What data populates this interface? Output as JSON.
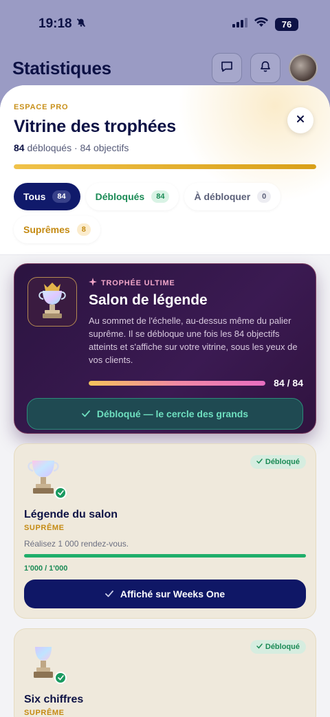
{
  "status_bar": {
    "time": "19:18",
    "battery": "76"
  },
  "header": {
    "title": "Statistiques"
  },
  "sheet": {
    "eyebrow": "ESPACE PRO",
    "title": "Vitrine des trophées",
    "unlocked_count": "84",
    "subtitle_rest": "débloqués · 84 objectifs",
    "progress": 1.0
  },
  "filters": [
    {
      "label": "Tous",
      "count": "84",
      "active": true
    },
    {
      "label": "Débloqués",
      "count": "84"
    },
    {
      "label": "À débloquer",
      "count": "0"
    },
    {
      "label": "Suprêmes",
      "count": "8"
    }
  ],
  "ultimate": {
    "eyebrow": "TROPHÉE ULTIME",
    "title": "Salon de légende",
    "description": "Au sommet de l'échelle, au-dessus même du palier suprême. Il se débloque une fois les 84 objectifs atteints et s'affiche sur votre vitrine, sous les yeux de vos clients.",
    "progress_text": "84 / 84",
    "progress": 1.0,
    "button": "Débloqué — le cercle des grands"
  },
  "trophies": [
    {
      "badge": "Débloqué",
      "name": "Légende du salon",
      "tier": "SUPRÊME",
      "description": "Réalisez 1 000 rendez-vous.",
      "progress_text": "1'000 / 1'000",
      "progress": 1.0,
      "button": "Affiché sur Weeks One"
    },
    {
      "badge": "Débloqué",
      "name": "Six chiffres",
      "tier": "SUPRÊME"
    }
  ]
}
